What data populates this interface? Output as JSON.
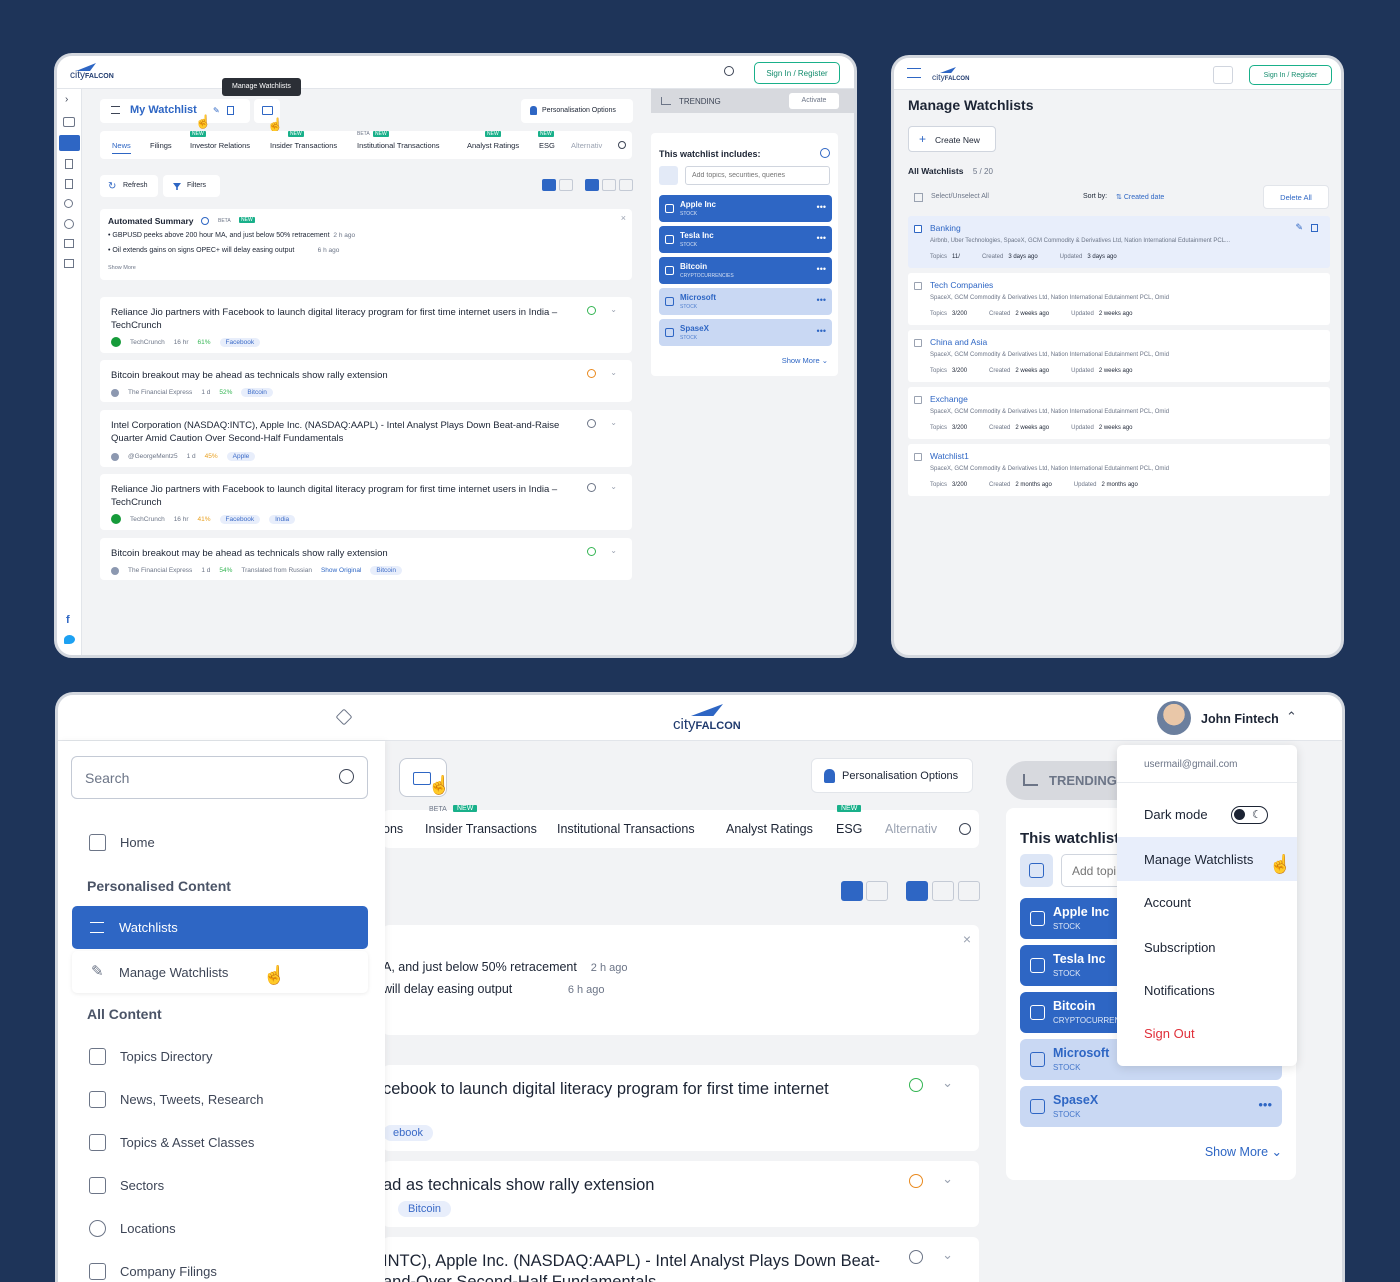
{
  "win1": {
    "sign_in": "Sign In / Register",
    "tooltip": "Manage Watchlists",
    "watchlist_title": "My Watchlist",
    "personalisation": "Personalisation Options",
    "tabs": [
      "News",
      "Filings",
      "Investor Relations",
      "Insider Transactions",
      "Institutional Transactions",
      "Analyst Ratings",
      "ESG",
      "Alternativ"
    ],
    "badges": {
      "new": "NEW",
      "beta": "BETA"
    },
    "refresh": "Refresh",
    "filters": "Filters",
    "summary": {
      "title": "Automated Summary",
      "items": [
        {
          "text": "GBPUSD peeks above 200 hour MA, and just below 50% retracement",
          "time": "2 h ago"
        },
        {
          "text": "Oil extends gains on signs OPEC+ will delay easing output",
          "time": "6 h ago"
        }
      ],
      "show_more": "Show More"
    },
    "news": [
      {
        "title": "Reliance Jio partners with Facebook to launch digital literacy program for first time internet users in India – TechCrunch",
        "source": "TechCrunch",
        "time": "16 hr",
        "score": "61%",
        "tags": [
          "Facebook"
        ]
      },
      {
        "title": "Bitcoin breakout may be ahead as technicals show rally extension",
        "source": "The Financial Express",
        "time": "1 d",
        "score": "52%",
        "tags": [
          "Bitcoin"
        ]
      },
      {
        "title": "Intel Corporation (NASDAQ:INTC), Apple Inc. (NASDAQ:AAPL) - Intel Analyst Plays Down Beat-and-Raise Quarter Amid Caution Over Second-Half Fundamentals",
        "source": "@GeorgeMentz5",
        "time": "1 d",
        "score": "45%",
        "tags": [
          "Apple"
        ]
      },
      {
        "title": "Reliance Jio partners with Facebook to launch digital literacy program for first time internet users in India – TechCrunch",
        "source": "TechCrunch",
        "time": "16 hr",
        "score": "41%",
        "tags": [
          "Facebook",
          "India"
        ]
      },
      {
        "title": "Bitcoin breakout may be ahead as technicals show rally extension",
        "source": "The Financial Express",
        "time": "1 d",
        "score": "54%",
        "extra": "Translated from Russian",
        "extra_link": "Show Original",
        "tags": [
          "Bitcoin"
        ]
      }
    ],
    "trending": "TRENDING",
    "activate": "Activate",
    "includes": "This watchlist includes:",
    "add_placeholder": "Add topics, securities, queries",
    "items": [
      {
        "name": "Apple Inc",
        "type": "STOCK"
      },
      {
        "name": "Tesla Inc",
        "type": "STOCK"
      },
      {
        "name": "Bitcoin",
        "type": "CRYPTOCURRENCIES"
      },
      {
        "name": "Microsoft",
        "type": "STOCK"
      },
      {
        "name": "SpaseX",
        "type": "STOCK"
      }
    ],
    "show_more": "Show More"
  },
  "win2": {
    "sign_in": "Sign In / Register",
    "title": "Manage Watchlists",
    "create_new": "Create New",
    "all_label": "All Watchlists",
    "count": "5 / 20",
    "select_all": "Select/Unselect All",
    "sort_by": "Sort by:",
    "sort_value": "Created date",
    "delete_all": "Delete All",
    "meta_labels": {
      "topics": "Topics",
      "created": "Created",
      "updated": "Updated"
    },
    "rows": [
      {
        "title": "Banking",
        "desc": "Airbnb, Uber Technologies, SpaceX, GCM Commodity & Derivatives Ltd, Nation International Edutainment PCL...",
        "topics": "11/",
        "created": "3 days ago",
        "updated": "3 days ago"
      },
      {
        "title": "Tech Companies",
        "desc": "SpaceX, GCM Commodity & Derivatives Ltd, Nation International Edutainment PCL, Omid",
        "topics": "3/200",
        "created": "2 weeks ago",
        "updated": "2 weeks ago"
      },
      {
        "title": "China and Asia",
        "desc": "SpaceX, GCM Commodity & Derivatives Ltd, Nation International Edutainment PCL, Omid",
        "topics": "3/200",
        "created": "2 weeks ago",
        "updated": "2 weeks ago"
      },
      {
        "title": "Exchange",
        "desc": "SpaceX, GCM Commodity & Derivatives Ltd, Nation International Edutainment PCL, Omid",
        "topics": "3/200",
        "created": "2 weeks ago",
        "updated": "2 weeks ago"
      },
      {
        "title": "Watchlist1",
        "desc": "SpaceX, GCM Commodity & Derivatives Ltd, Nation International Edutainment PCL, Omid",
        "topics": "3/200",
        "created": "2 months ago",
        "updated": "2 months ago"
      }
    ]
  },
  "win3": {
    "user_name": "John Fintech",
    "search_placeholder": "Search",
    "home": "Home",
    "personalised": "Personalised Content",
    "watchlists": "Watchlists",
    "manage": "Manage Watchlists",
    "all_content": "All Content",
    "nav": [
      "Topics Directory",
      "News, Tweets, Research",
      "Topics & Asset Classes",
      "Sectors",
      "Locations",
      "Company Filings"
    ],
    "personalisation": "Personalisation Options",
    "tabs": [
      "ons",
      "Insider Transactions",
      "Institutional Transactions",
      "Analyst Ratings",
      "ESG",
      "Alternativ"
    ],
    "summary_lines": [
      {
        "text": "A, and just below 50% retracement",
        "time": "2 h ago"
      },
      {
        "text": "will delay easing output",
        "time": "6 h ago"
      }
    ],
    "news": [
      {
        "title": "cebook to launch digital literacy program for first time internet",
        "tag": "ebook"
      },
      {
        "title": "ad as technicals show rally extension",
        "tag": "Bitcoin"
      },
      {
        "title": "INTC), Apple Inc. (NASDAQ:AAPL) - Intel Analyst Plays Down Beat-and-Over Second-Half Fundamentals"
      }
    ],
    "trending": "TRENDING",
    "includes": "This watchlist",
    "add_placeholder": "Add topi",
    "items": [
      {
        "name": "Apple Inc",
        "type": "STOCK"
      },
      {
        "name": "Tesla Inc",
        "type": "STOCK"
      },
      {
        "name": "Bitcoin",
        "type": "CRYPTOCURRENCIES"
      },
      {
        "name": "Microsoft",
        "type": "STOCK"
      },
      {
        "name": "SpaseX",
        "type": "STOCK"
      }
    ],
    "show_more": "Show More",
    "dropdown": {
      "email": "usermail@gmail.com",
      "dark_mode": "Dark mode",
      "manage": "Manage Watchlists",
      "account": "Account",
      "subscription": "Subscription",
      "notifications": "Notifications",
      "sign_out": "Sign Out"
    }
  },
  "logo": {
    "a": "city",
    "b": "FALCON"
  },
  "colors": {
    "bg": "#1e3459",
    "primary": "#2e66c4",
    "accent": "#19b08a",
    "danger": "#e0303a"
  }
}
